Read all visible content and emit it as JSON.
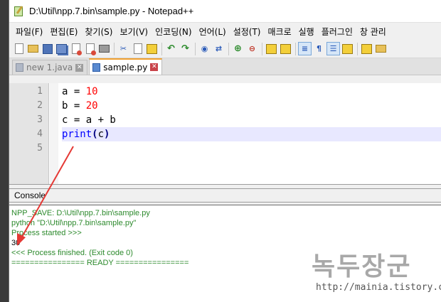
{
  "window": {
    "title": "D:\\Util\\npp.7.bin\\sample.py - Notepad++"
  },
  "menu": [
    "파일(F)",
    "편집(E)",
    "찾기(S)",
    "보기(V)",
    "인코딩(N)",
    "언어(L)",
    "설정(T)",
    "매크로",
    "실행",
    "플러그인",
    "창 관리"
  ],
  "toolbar": {
    "icons": [
      "new-file-icon",
      "open-folder-icon",
      "save-icon",
      "save-all-icon",
      "close-icon",
      "close-all-icon",
      "print-icon",
      "cut-icon",
      "copy-icon",
      "paste-icon",
      "undo-icon",
      "redo-icon",
      "find-icon",
      "replace-icon",
      "zoom-in-icon",
      "zoom-out-icon",
      "sync-vertical-icon",
      "sync-horizontal-icon",
      "word-wrap-icon",
      "show-all-chars-icon",
      "indent-guide-icon",
      "document-map-icon",
      "function-list-icon",
      "folder-workspace-icon"
    ]
  },
  "tabs": [
    {
      "label": "new 1.java",
      "active": false
    },
    {
      "label": "sample.py",
      "active": true
    }
  ],
  "editor": {
    "line_numbers": [
      "1",
      "2",
      "3",
      "4",
      "5"
    ],
    "code": {
      "l1_var": "a",
      "l1_op": " = ",
      "l1_val": "10",
      "l2_var": "b",
      "l2_op": " = ",
      "l2_val": "20",
      "l3": "c = a + b",
      "l4_fn": "print",
      "l4_open": "(",
      "l4_arg": "c",
      "l4_close": ")"
    }
  },
  "console": {
    "title": "Console",
    "lines": [
      "NPP_SAVE: D:\\Util\\npp.7.bin\\sample.py",
      "python \"D:\\Util\\npp.7.bin\\sample.py\"",
      "Process started >>>",
      "30",
      "<<< Process finished. (Exit code 0)",
      "================ READY ================"
    ]
  },
  "watermark": {
    "title": "녹두장군",
    "url": "http://mainia.tistory.com"
  },
  "colors": {
    "accent_tab": "#f0a030",
    "arrow": "#e53935",
    "console_green": "#2d8a2d",
    "current_line": "#e8e8ff"
  }
}
